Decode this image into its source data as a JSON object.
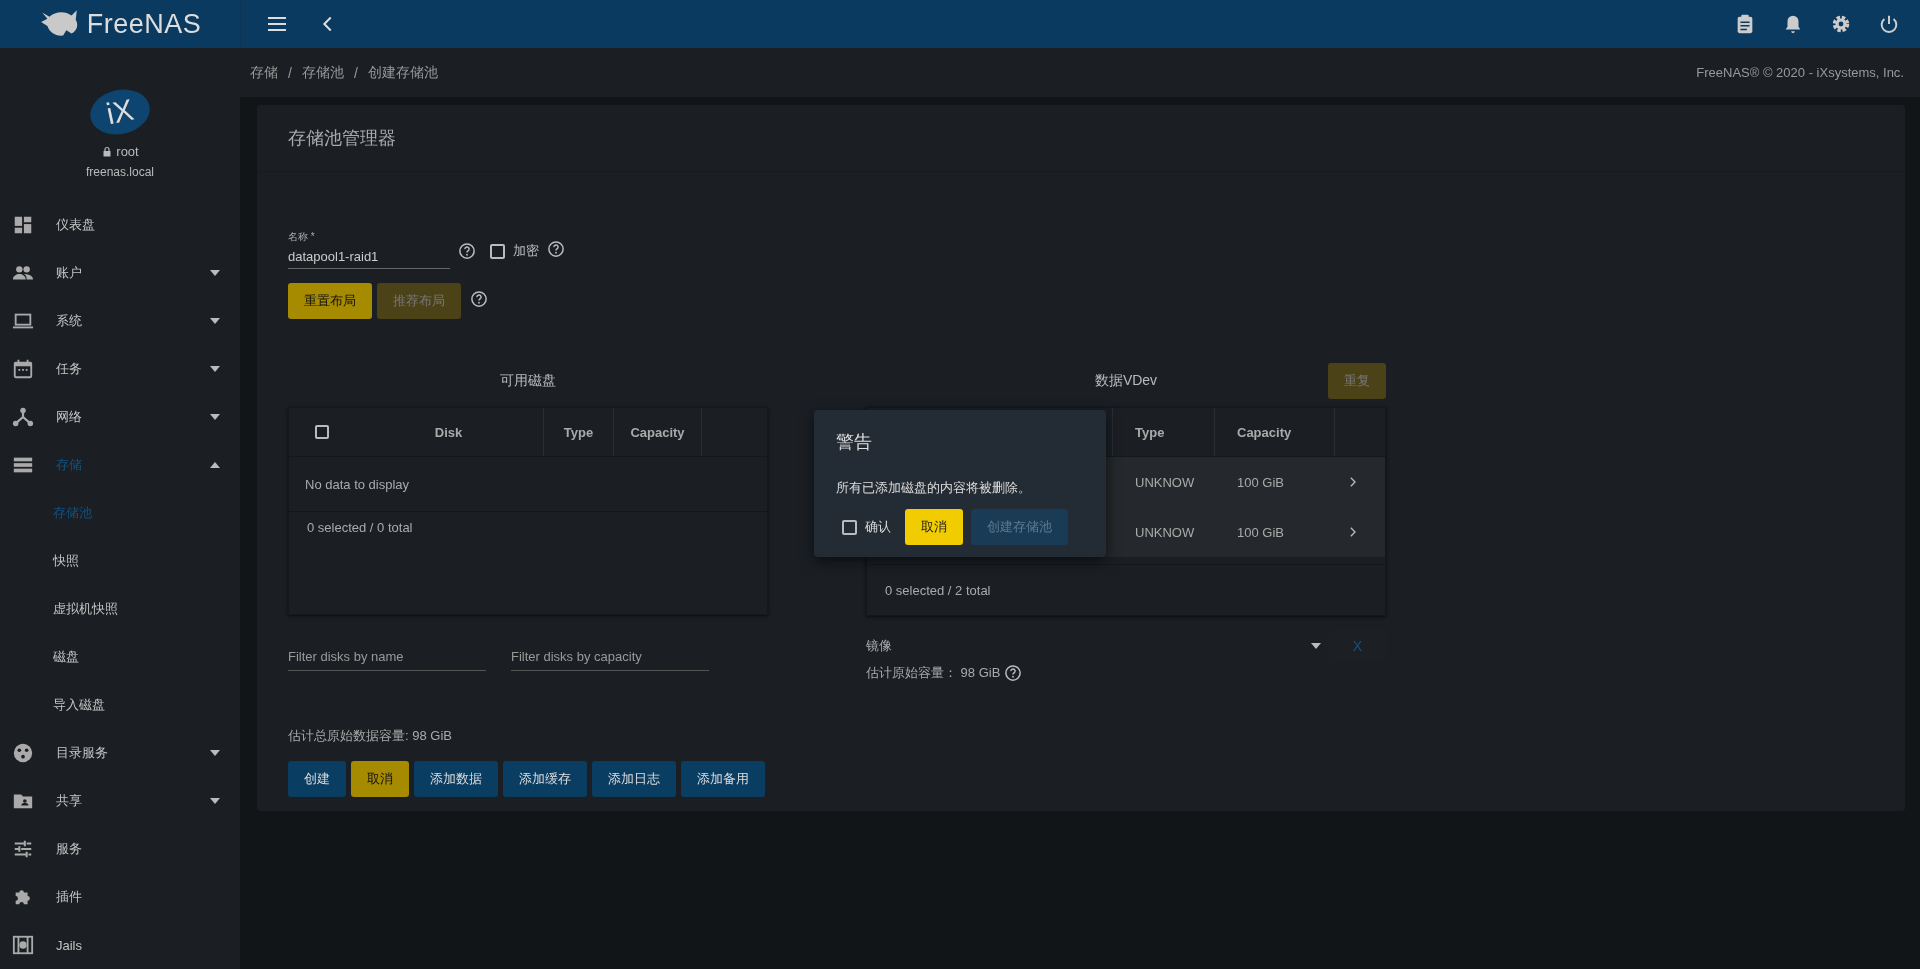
{
  "topbar": {
    "brand": "FreeNAS"
  },
  "user": {
    "org_logo": "iX",
    "name": "root",
    "host": "freenas.local"
  },
  "sidebar": {
    "items": [
      {
        "label": "仪表盘",
        "kind": "link",
        "selected": false
      },
      {
        "label": "账户",
        "kind": "group",
        "selected": false,
        "expanded": false
      },
      {
        "label": "系统",
        "kind": "group",
        "selected": false,
        "expanded": false
      },
      {
        "label": "任务",
        "kind": "group",
        "selected": false,
        "expanded": false
      },
      {
        "label": "网络",
        "kind": "group",
        "selected": false,
        "expanded": false
      },
      {
        "label": "存储",
        "kind": "group",
        "selected": true,
        "expanded": true,
        "children": [
          {
            "label": "存储池",
            "selected": true
          },
          {
            "label": "快照",
            "selected": false
          },
          {
            "label": "虚拟机快照",
            "selected": false
          },
          {
            "label": "磁盘",
            "selected": false
          },
          {
            "label": "导入磁盘",
            "selected": false
          }
        ]
      },
      {
        "label": "目录服务",
        "kind": "group",
        "selected": false,
        "expanded": false
      },
      {
        "label": "共享",
        "kind": "group",
        "selected": false,
        "expanded": false
      },
      {
        "label": "服务",
        "kind": "link",
        "selected": false
      },
      {
        "label": "插件",
        "kind": "link",
        "selected": false
      },
      {
        "label": "Jails",
        "kind": "link",
        "selected": false
      }
    ]
  },
  "breadcrumb": {
    "items": [
      "存储",
      "存储池",
      "创建存储池"
    ],
    "separators": [
      "/",
      "/"
    ]
  },
  "copyright": "FreeNAS® © 2020 - iXsystems, Inc.",
  "manager": {
    "title": "存储池管理器",
    "name_field": {
      "label": "名称 *",
      "value": "datapool1-raid1"
    },
    "encrypt": {
      "label": "加密",
      "checked": false
    },
    "layout_buttons": [
      {
        "label": "重置布局",
        "disabled": false
      },
      {
        "label": "推荐布局",
        "disabled": true
      }
    ],
    "available": {
      "title": "可用磁盘",
      "all_checked": false,
      "columns": [
        "Disk",
        "Type",
        "Capacity"
      ],
      "empty": "No data to display",
      "footer": "0 selected / 0 total"
    },
    "filters": [
      {
        "placeholder": "Filter disks by name"
      },
      {
        "placeholder": "Filter disks by capacity"
      }
    ],
    "vdev": {
      "title": "数据VDev",
      "repeat": {
        "label": "重复",
        "disabled": true
      },
      "columns": [
        "Type",
        "Capacity"
      ],
      "rows": [
        {
          "type": "UNKNOW",
          "capacity": "100 GiB"
        },
        {
          "type": "UNKNOW",
          "capacity": "100 GiB"
        }
      ],
      "footer": "0 selected / 2 total",
      "layout": "镜像",
      "capacity": "估计原始容量： 98 GiB",
      "remove": "X"
    },
    "total": "估计总原始数据容量: 98 GiB",
    "actions": [
      {
        "label": "创建",
        "kind": "primary"
      },
      {
        "label": "取消",
        "kind": "accent"
      },
      {
        "label": "添加数据",
        "kind": "primary"
      },
      {
        "label": "添加缓存",
        "kind": "primary"
      },
      {
        "label": "添加日志",
        "kind": "primary"
      },
      {
        "label": "添加备用",
        "kind": "primary"
      }
    ]
  },
  "dialog": {
    "title": "警告",
    "message": "所有已添加磁盘的内容将被删除。",
    "confirm": {
      "label": "确认",
      "checked": false
    },
    "buttons": [
      {
        "label": "取消",
        "kind": "accent",
        "disabled": false
      },
      {
        "label": "创建存储池",
        "kind": "primary",
        "disabled": true
      }
    ]
  }
}
